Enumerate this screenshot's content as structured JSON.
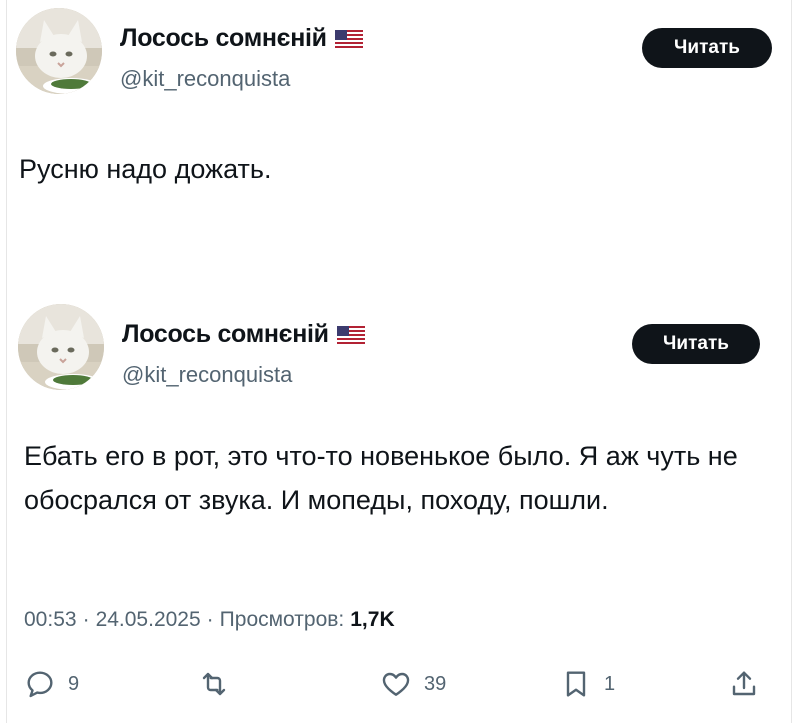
{
  "tweets": [
    {
      "author": {
        "display_name": "Лосось сомнєній",
        "handle": "@kit_reconquista",
        "flag": "us-flag"
      },
      "follow_label": "Читать",
      "text": "Русню надо дожать."
    },
    {
      "author": {
        "display_name": "Лосось сомнєній",
        "handle": "@kit_reconquista",
        "flag": "us-flag"
      },
      "follow_label": "Читать",
      "text": "Ебать его в рот, это что-то новенькое было. Я аж чуть не обосрался от звука. И мопеды, походу, пошли.",
      "meta": {
        "time": "00:53",
        "separator": "·",
        "date": "24.05.2025",
        "views_label": "Просмотров:",
        "views_count": "1,7K"
      },
      "actions": {
        "reply_count": "9",
        "retweet_count": "",
        "like_count": "39",
        "bookmark_count": "1"
      }
    }
  ],
  "icons": {
    "reply": "reply-icon",
    "retweet": "retweet-icon",
    "like": "heart-icon",
    "bookmark": "bookmark-icon",
    "share": "share-icon"
  },
  "colors": {
    "text": "#0f1419",
    "secondary": "#536471",
    "button_bg": "#0f1419",
    "button_text": "#ffffff"
  }
}
